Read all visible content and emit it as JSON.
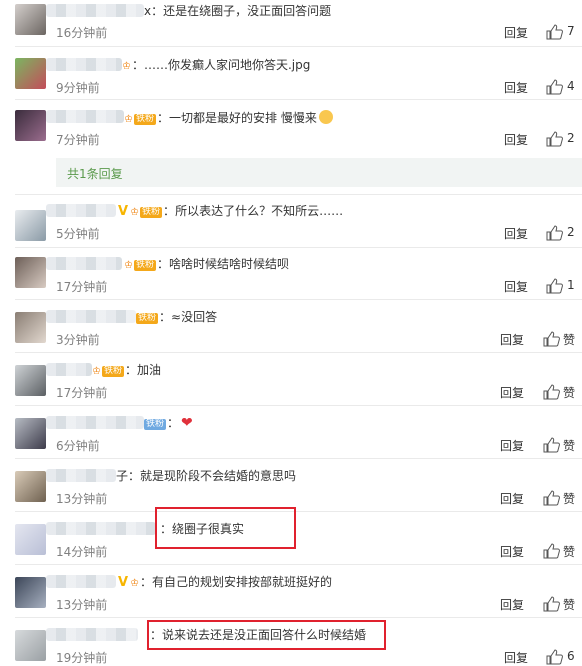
{
  "comments": [
    {
      "text": "还是在绕圈子，没正面回答问题",
      "time": "16分钟前",
      "likes": "7",
      "reply": "回复"
    },
    {
      "text": "……你发癫人家问地你答天.jpg",
      "time": "9分钟前",
      "likes": "4",
      "reply": "回复"
    },
    {
      "badge": "铁粉",
      "text": "一切都是最好的安排 慢慢来",
      "time": "7分钟前",
      "likes": "2",
      "reply": "回复"
    },
    {
      "badge": "铁粉",
      "text": "所以表达了什么？不知所云……",
      "time": "5分钟前",
      "likes": "2",
      "reply": "回复"
    },
    {
      "badge": "铁粉",
      "text": "啥啥时候结啥时候结呗",
      "time": "17分钟前",
      "likes": "1",
      "reply": "回复"
    },
    {
      "badge": "铁粉",
      "text": "≈没回答",
      "time": "3分钟前",
      "likes": "赞",
      "reply": "回复"
    },
    {
      "badge": "铁粉",
      "text": "加油",
      "time": "17分钟前",
      "likes": "赞",
      "reply": "回复"
    },
    {
      "badge": "铁粉",
      "text": "",
      "time": "6分钟前",
      "likes": "赞",
      "reply": "回复"
    },
    {
      "name_tail": "子",
      "text": "就是现阶段不会结婚的意思吗",
      "time": "13分钟前",
      "likes": "赞",
      "reply": "回复"
    },
    {
      "text": "绕圈子很真实",
      "time": "14分钟前",
      "likes": "赞",
      "reply": "回复"
    },
    {
      "text": "有自己的规划安排按部就班挺好的",
      "time": "13分钟前",
      "likes": "赞",
      "reply": "回复"
    },
    {
      "text": "说来说去还是没正面回答什么时候结婚",
      "time": "19分钟前",
      "likes": "6",
      "reply": "回复"
    }
  ],
  "name_tail_first": "x",
  "sub_replies_label": "共1条回复",
  "colon": "：",
  "colors": {
    "highlight": "#e0212e",
    "time": "#808080",
    "link": "#5b9a4c",
    "badge": "#f4a81a"
  }
}
